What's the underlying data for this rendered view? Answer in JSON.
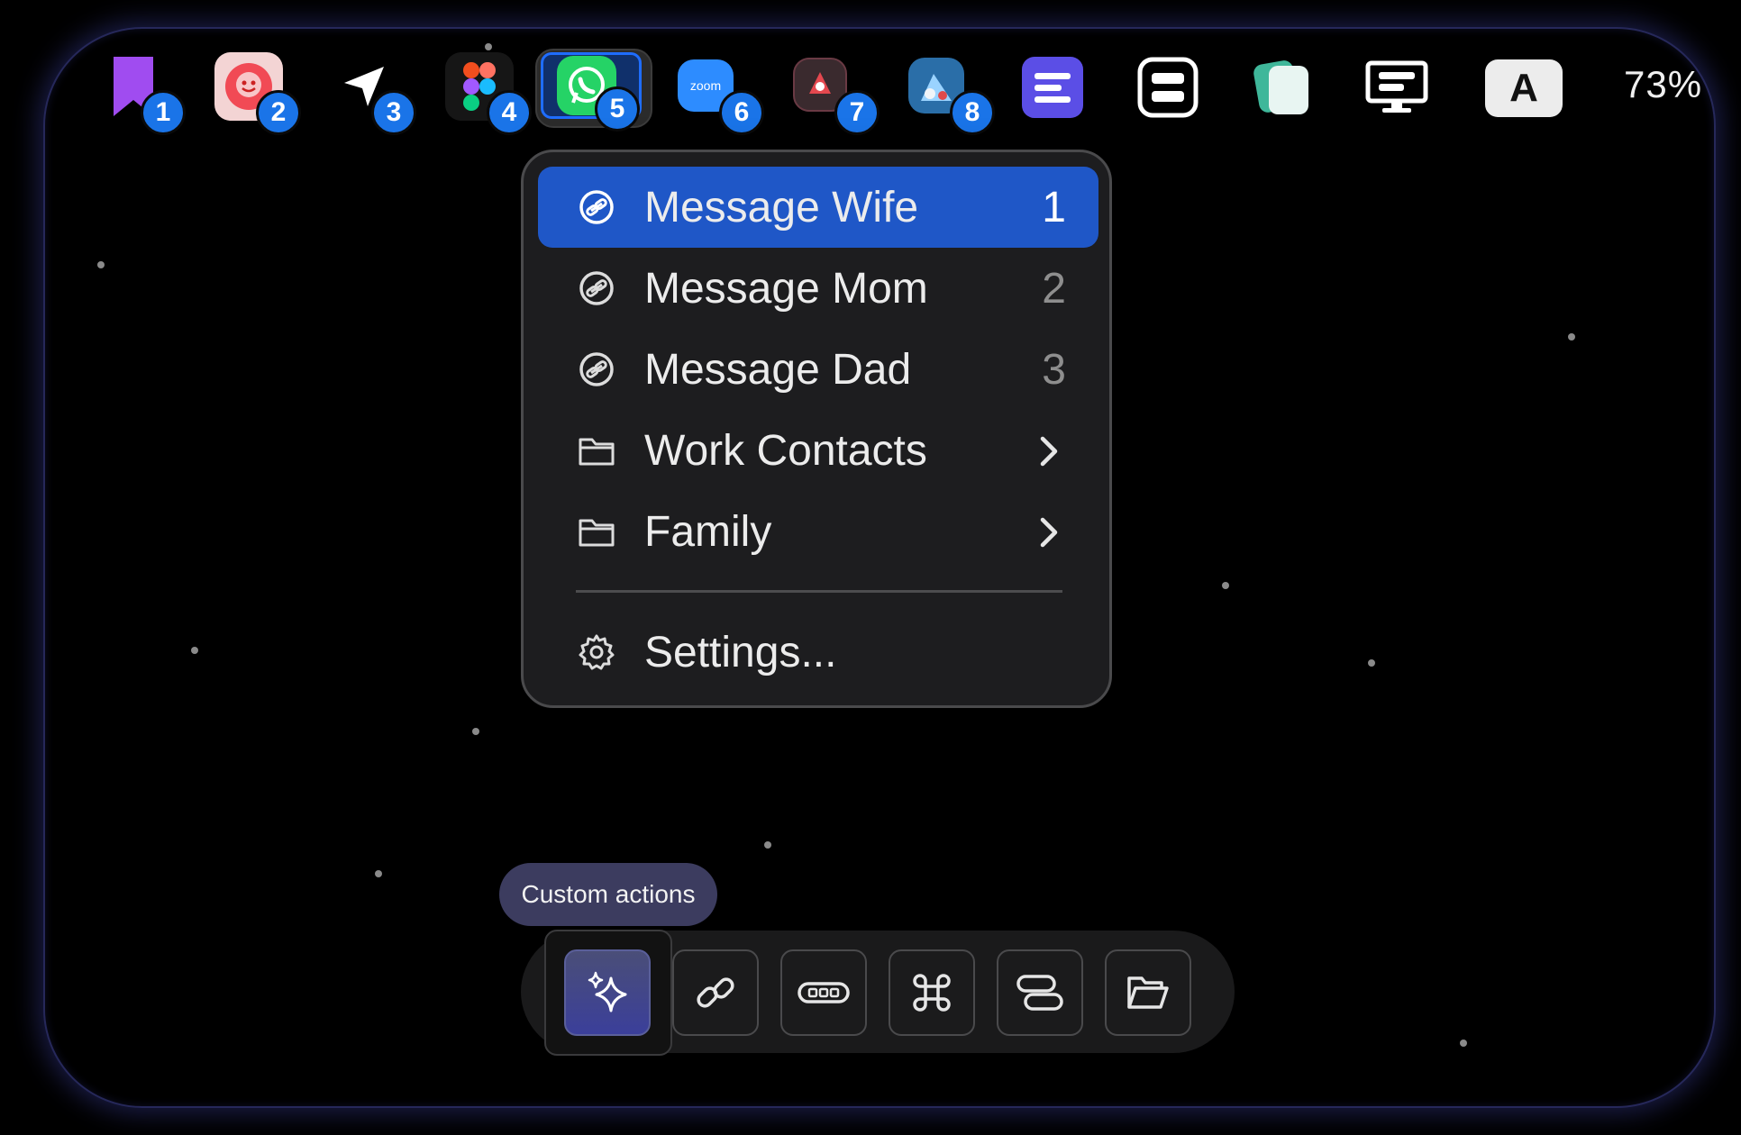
{
  "menubar": {
    "apps": [
      {
        "name": "bookmark-app-icon",
        "badge": "1"
      },
      {
        "name": "flower-app-icon",
        "badge": "2"
      },
      {
        "name": "location-arrow-app-icon",
        "badge": "3"
      },
      {
        "name": "figma-app-icon",
        "badge": "4"
      },
      {
        "name": "whatsapp-app-icon",
        "badge": "5"
      },
      {
        "name": "zoom-app-icon",
        "badge": "6"
      },
      {
        "name": "screen-recorder-app-icon",
        "badge": "7"
      },
      {
        "name": "utility-app-icon",
        "badge": "8"
      }
    ],
    "zoom_label": "zoom",
    "input_source": "A",
    "battery_percent": "73%"
  },
  "context_menu": {
    "items": [
      {
        "label": "Message Wife",
        "key": "1",
        "icon": "link-icon",
        "active": true
      },
      {
        "label": "Message Mom",
        "key": "2",
        "icon": "link-icon"
      },
      {
        "label": "Message Dad",
        "key": "3",
        "icon": "link-icon"
      },
      {
        "label": "Work Contacts",
        "icon": "folder-icon",
        "submenu": true
      },
      {
        "label": "Family",
        "icon": "folder-icon",
        "submenu": true
      }
    ],
    "settings_label": "Settings..."
  },
  "tooltip": "Custom actions",
  "toolbar": {
    "buttons": [
      "sparkles-icon",
      "link-icon",
      "keyboard-icon",
      "command-icon",
      "toggle-icon",
      "folder-icon"
    ]
  },
  "colors": {
    "accent": "#1f57c7",
    "badge": "#1a74e8",
    "whatsapp": "#25d366",
    "zoom": "#2d8cff"
  }
}
